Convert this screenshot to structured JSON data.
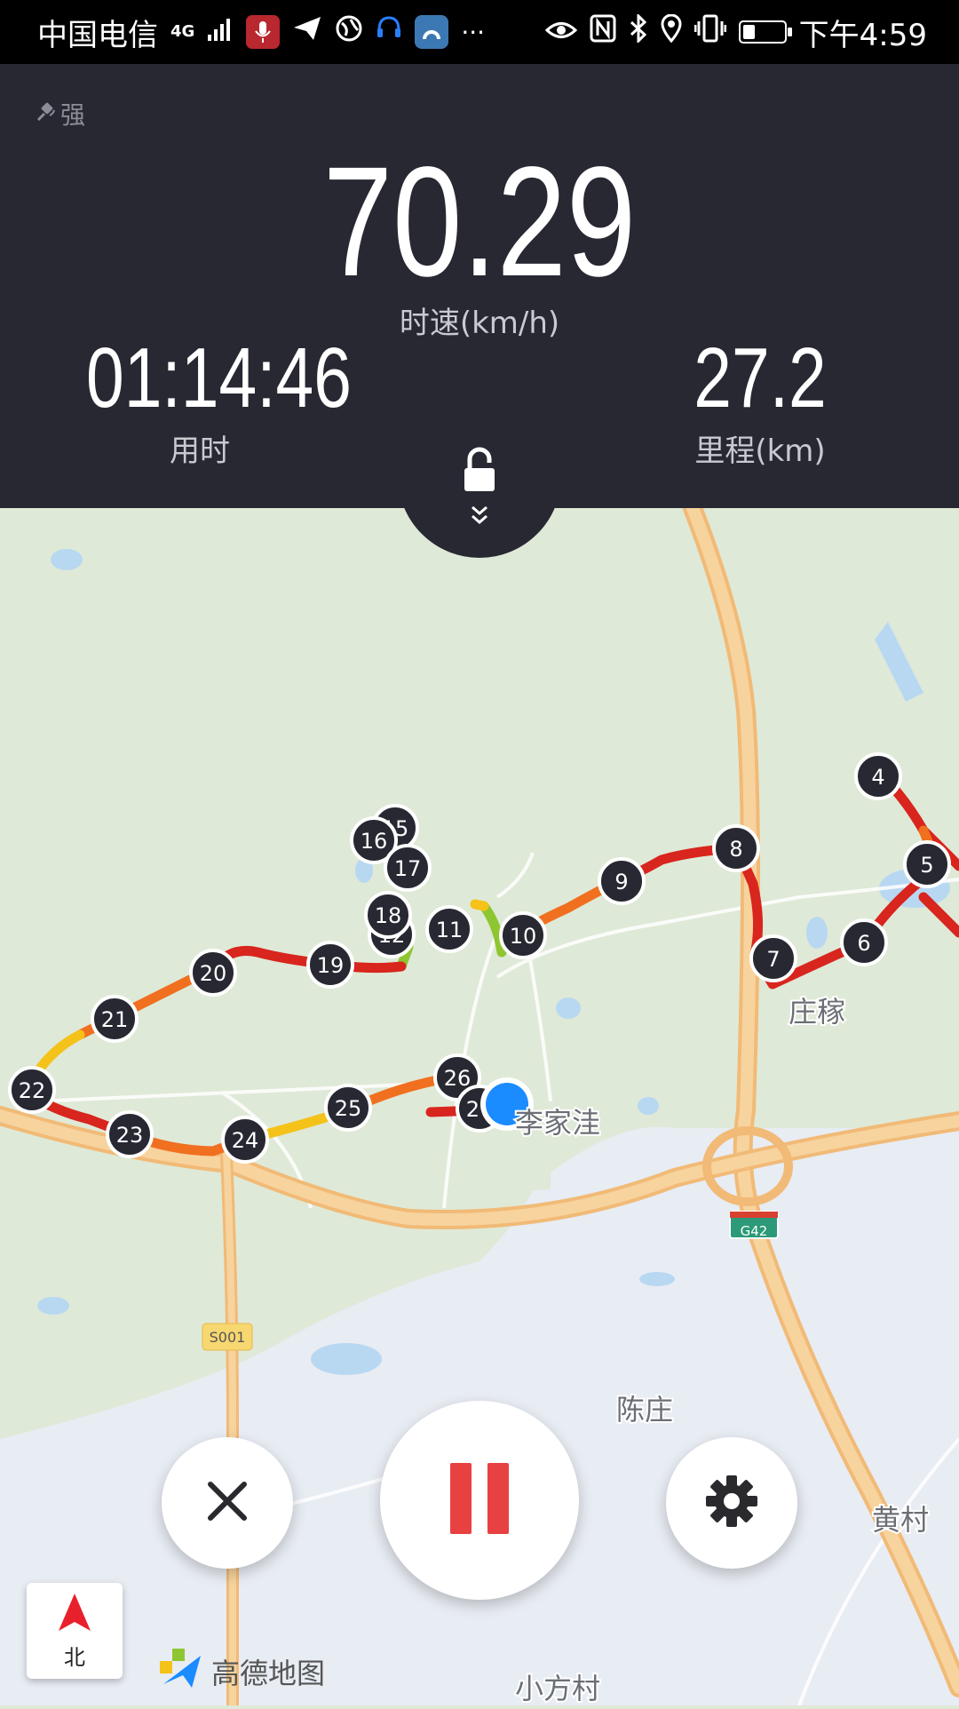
{
  "status_bar": {
    "carrier": "中国电信",
    "network": "4G",
    "time": "下午4:59",
    "battery_level": 0.3,
    "icons": [
      "signal-icon",
      "mic-icon",
      "send-icon",
      "globe-icon",
      "headset-icon",
      "app-icon",
      "more-icon",
      "eye-icon",
      "nfc-icon",
      "bluetooth-icon",
      "location-icon",
      "vibrate-icon",
      "battery-icon"
    ]
  },
  "gps": {
    "strength_label": "强",
    "icon": "satellite-icon"
  },
  "speed": {
    "value": "70.29",
    "label": "时速(km/h)"
  },
  "elapsed": {
    "value": "01:14:46",
    "label": "用时"
  },
  "distance": {
    "value": "27.2",
    "label": "里程(km)"
  },
  "lock": {
    "icon": "lock-icon",
    "expand_icon": "chevron-double-down-icon"
  },
  "map": {
    "place_labels": [
      "庄稼",
      "李家洼",
      "陈庄",
      "黄村",
      "小方村"
    ],
    "road_badges": [
      "G42",
      "S001"
    ],
    "km_markers": [
      "4",
      "5",
      "6",
      "7",
      "8",
      "9",
      "10",
      "11",
      "12",
      "15",
      "16",
      "17",
      "18",
      "19",
      "20",
      "21",
      "22",
      "23",
      "24",
      "25",
      "26",
      "27"
    ],
    "route_colors": [
      "#d8251d",
      "#f07020",
      "#f5c21a",
      "#8ec632"
    ],
    "current_position_color": "#1a8cff"
  },
  "controls": {
    "close_icon": "close-icon",
    "pause_icon": "pause-icon",
    "settings_icon": "gear-icon",
    "pause_color": "#e84141"
  },
  "compass": {
    "label": "北",
    "arrow_color": "#e8202c"
  },
  "brand": {
    "name": "高德地图"
  }
}
